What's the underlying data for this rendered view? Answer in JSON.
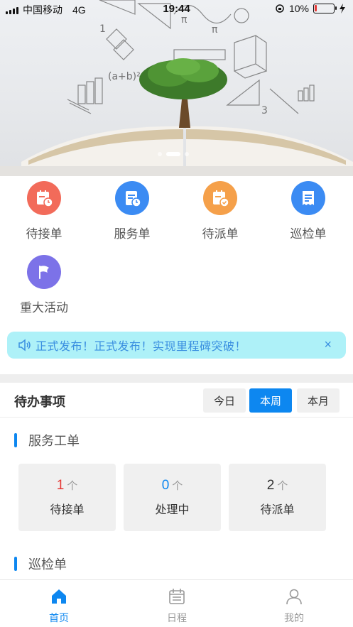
{
  "status_bar": {
    "carrier": "中国移动",
    "network": "4G",
    "time": "19:44",
    "battery_text": "10%",
    "battery_level": 0.1
  },
  "banner": {
    "slide_count": 3,
    "active_slide": 1
  },
  "shortcuts": [
    {
      "label": "待接单",
      "color": "#f26b5a",
      "icon": "calendar-clock-icon"
    },
    {
      "label": "服务单",
      "color": "#3b8bf3",
      "icon": "document-clock-icon"
    },
    {
      "label": "待派单",
      "color": "#f5a04a",
      "icon": "calendar-check-icon"
    },
    {
      "label": "巡检单",
      "color": "#3b8bf3",
      "icon": "receipt-icon"
    },
    {
      "label": "重大活动",
      "color": "#7c72e8",
      "icon": "flag-icon"
    }
  ],
  "notice": {
    "text": "正式发布！正式发布！实现里程碑突破！",
    "close": "×"
  },
  "todo": {
    "title": "待办事项",
    "filters": [
      {
        "label": "今日",
        "active": false
      },
      {
        "label": "本周",
        "active": true
      },
      {
        "label": "本月",
        "active": false
      }
    ],
    "service_section": "服务工单",
    "service_cards": [
      {
        "count": "1",
        "unit": "个",
        "label": "待接单",
        "color": "#e53935"
      },
      {
        "count": "0",
        "unit": "个",
        "label": "处理中",
        "color": "#0d87f0"
      },
      {
        "count": "2",
        "unit": "个",
        "label": "待派单",
        "color": "#333333"
      }
    ],
    "inspection_section": "巡检单"
  },
  "tabbar": [
    {
      "label": "首页",
      "icon": "home-icon",
      "active": true
    },
    {
      "label": "日程",
      "icon": "calendar-icon",
      "active": false
    },
    {
      "label": "我的",
      "icon": "user-icon",
      "active": false
    }
  ]
}
